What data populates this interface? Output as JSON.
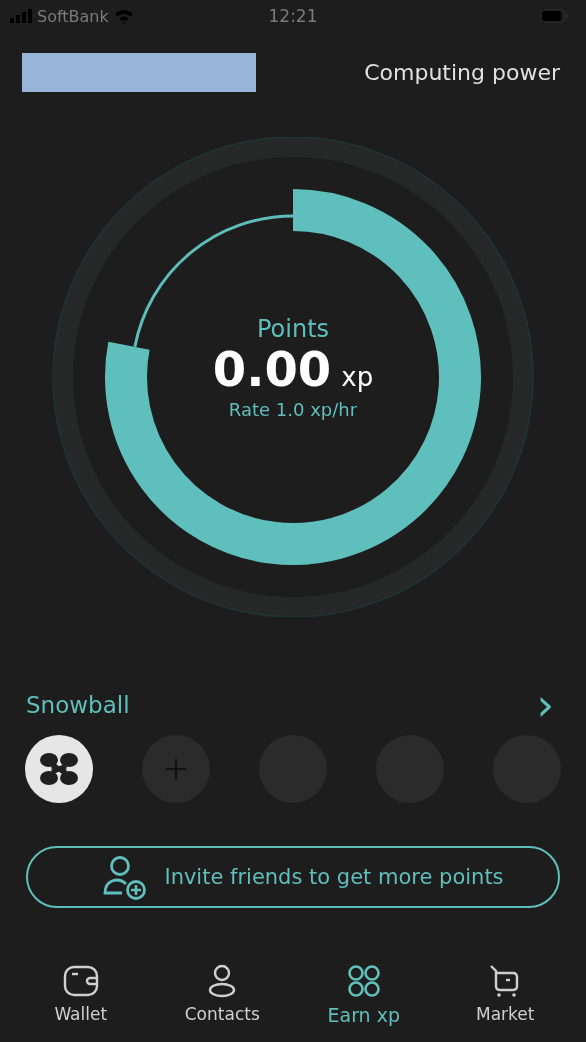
{
  "status_bar": {
    "carrier": "SoftBank",
    "time": "12:21"
  },
  "header": {
    "redacted": true,
    "title": "Computing power"
  },
  "gauge": {
    "label": "Points",
    "value": "0.00",
    "unit": "xp",
    "rate": "Rate 1.0 xp/hr"
  },
  "snowball": {
    "title": "Snowball",
    "arrow": "›",
    "members": [
      {
        "kind": "logo"
      },
      {
        "kind": "add"
      },
      {
        "kind": "empty"
      },
      {
        "kind": "empty"
      },
      {
        "kind": "empty"
      }
    ]
  },
  "invite_button": {
    "label": "Invite friends to get more points"
  },
  "tab_bar": [
    {
      "label": "Wallet",
      "selected": false
    },
    {
      "label": "Contacts",
      "selected": false
    },
    {
      "label": "Earn xp",
      "selected": true
    },
    {
      "label": "Market",
      "selected": false
    }
  ]
}
